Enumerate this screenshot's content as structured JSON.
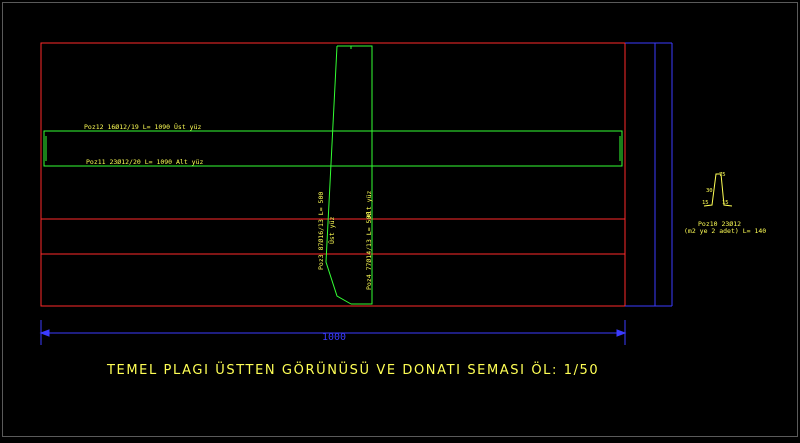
{
  "drawing": {
    "title": "TEMEL PLAGI ÜSTTEN GÖRÜNÜSÜ VE DONATI SEMASI ÖL: 1/50",
    "dimension_label": "1000",
    "colors": {
      "background": "#000000",
      "outline": "#ff2a2a",
      "rebar": "#33ff33",
      "text": "#ffff55",
      "dimension": "#3b3bff"
    }
  },
  "labels": {
    "pos12": "Poz12 16Ø12/19 L= 1090  Üst yüz",
    "pos11": "Poz11 23Ø12/20 L= 1090  Alt yüz",
    "pos3": "Poz3 87Ø16/13 L= 500",
    "pos3_face": "Üst yüz",
    "pos4": "Poz4 77Ø14/13 L= 500",
    "pos4_face": "Alt yüz",
    "pos10_line1": "Poz10   23Ø12",
    "pos10_line2": "(m2 ye 2 adet)  L= 140",
    "detail_dim_top": "75",
    "detail_dim_left": "15",
    "detail_dim_mid": "30",
    "detail_dim_right": "15"
  }
}
